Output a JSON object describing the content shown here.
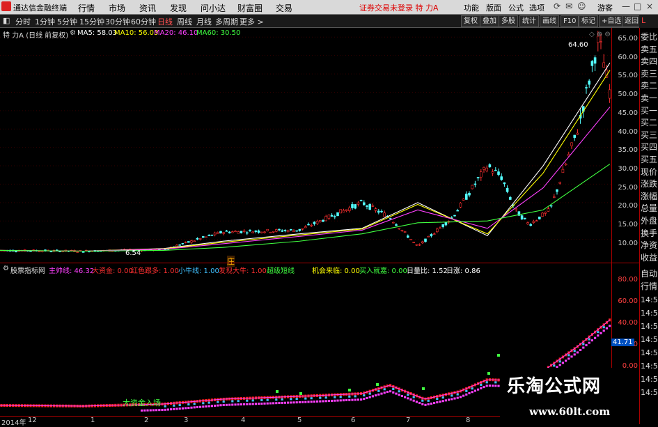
{
  "titlebar": {
    "app_name": "通达信金融终端",
    "menus": [
      "行情",
      "市场",
      "资讯",
      "发现",
      "问小达",
      "财富圈",
      "交易"
    ],
    "notice": "证券交易未登录  特 力A",
    "right_menus": [
      "功能",
      "版面",
      "公式",
      "选项"
    ],
    "guest": "游客",
    "window_buttons": [
      "—",
      "□",
      "×"
    ]
  },
  "toolbar": {
    "periods": [
      "分时",
      "1分钟",
      "5分钟",
      "15分钟",
      "30分钟",
      "60分钟",
      "日线",
      "周线",
      "月线",
      "多周期",
      "更多 >"
    ],
    "active_period": "日线",
    "right_buttons": [
      "复权",
      "叠加",
      "多股",
      "统计",
      "画线",
      "F10",
      "标记",
      "+自选",
      "返回"
    ]
  },
  "main_chart": {
    "stock_label": "特 力A (日线 前复权)",
    "ma": [
      {
        "label": "MA5: 58.03",
        "color": "#ffffff"
      },
      {
        "label": "MA10: 56.03",
        "color": "#ffff00"
      },
      {
        "label": "MA20: 46.10",
        "color": "#ff40ff"
      },
      {
        "label": "MA60: 30.50",
        "color": "#40ff40"
      }
    ],
    "high_label": "64.60",
    "low_label": "6.54",
    "marker_label": "庄",
    "y_ticks": [
      "65.00",
      "60.00",
      "55.00",
      "50.00",
      "45.00",
      "40.00",
      "35.00",
      "30.00",
      "25.00",
      "20.00",
      "15.00",
      "10.00"
    ]
  },
  "indicator": {
    "name": "股票指标网",
    "items": [
      {
        "label": "主帅线: 46.32",
        "color": "#ff40ff"
      },
      {
        "label": "大资金: 0.00",
        "color": "#ff3030"
      },
      {
        "label": "红色跟多: 1.00",
        "color": "#ff3030"
      },
      {
        "label": "小牛线: 1.00",
        "color": "#40c0ff"
      },
      {
        "label": "发现大牛: 1.00",
        "color": "#ff3030"
      },
      {
        "label": "超级短线",
        "color": "#40ff40"
      },
      {
        "label": "机会来临: 0.00",
        "color": "#ffff00"
      },
      {
        "label": "买入就嘉: 0.00",
        "color": "#40ff40"
      },
      {
        "label": "日量比: 1.52",
        "color": "#ffffff"
      },
      {
        "label": "日涨: 0.86",
        "color": "#ffffff"
      }
    ],
    "annotation": "大资金入场",
    "value_label": "41.71",
    "y_ticks": [
      "80.00",
      "60.00",
      "40.00",
      "20.00",
      "0.00"
    ]
  },
  "side_panel": {
    "top_letters": "L",
    "tabs": [
      "委比",
      "卖五",
      "卖四",
      "卖三",
      "卖二",
      "卖一",
      "买一",
      "买二",
      "买三",
      "买四",
      "买五",
      "现价",
      "涨跌",
      "涨幅",
      "总量",
      "外盘",
      "换手",
      "净资",
      "收益"
    ],
    "lower_tabs": [
      "自动",
      "行情"
    ],
    "times": [
      "14:5",
      "14:5",
      "14:5",
      "14:5",
      "14:5",
      "14:5",
      "14:5",
      "14:5"
    ]
  },
  "time_axis": {
    "labels": [
      "2014年",
      "12",
      "1",
      "2",
      "3",
      "4",
      "5",
      "6",
      "7",
      "8"
    ]
  },
  "watermark": {
    "line1": "乐淘公式网",
    "line2": "www.60lt.com"
  },
  "chart_data": {
    "type": "line",
    "title": "特 力A (日线 前复权)",
    "ylim": [
      5,
      66
    ],
    "x": [
      "2014-12",
      "2015-01",
      "2015-02",
      "2015-03",
      "2015-04",
      "2015-05",
      "2015-06",
      "2015-07",
      "2015-08"
    ],
    "series": [
      {
        "name": "MA5",
        "color": "#ffffff",
        "values": [
          7,
          6.8,
          7.5,
          9.5,
          11.5,
          13,
          20,
          11,
          30,
          58
        ]
      },
      {
        "name": "MA10",
        "color": "#ffff00",
        "values": [
          7,
          6.8,
          7.4,
          9.2,
          11.2,
          12.8,
          19.5,
          11.5,
          28,
          56
        ]
      },
      {
        "name": "MA20",
        "color": "#ff40ff",
        "values": [
          7,
          6.8,
          7.3,
          8.8,
          10.8,
          12.5,
          18,
          13,
          24,
          46
        ]
      },
      {
        "name": "MA60",
        "color": "#40ff40",
        "values": [
          7,
          6.8,
          7,
          7.8,
          9.5,
          11.5,
          14.5,
          15,
          18,
          30.5
        ]
      }
    ]
  }
}
